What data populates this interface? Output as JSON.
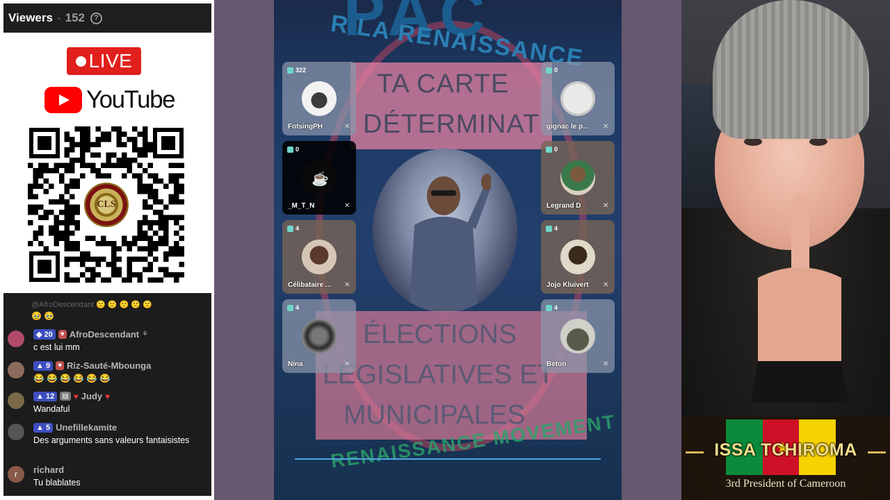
{
  "viewers": {
    "label": "Viewers",
    "separator": "·",
    "count": "152",
    "help_icon": "question-circle-icon"
  },
  "live_badge": {
    "text": "LIVE"
  },
  "youtube": {
    "text": "YouTube"
  },
  "qr_seal": {
    "text": "CLS"
  },
  "chat": {
    "faded_top": "@AfroDescendant 🙁 🙁 🙁 🙁 🙁",
    "faded_emojis": "🥹 🥹",
    "messages": [
      {
        "level": "20",
        "name": "AfroDescendant",
        "text": "c est lui mm",
        "avatar_color": "#b24a6a"
      },
      {
        "level": "9",
        "name": "Riz-Sauté-Mbounga",
        "text": "😂 😂 😂 😂 😂 😂",
        "avatar_color": "#8d6b5a"
      },
      {
        "level": "12",
        "name": "Judy",
        "text": "Wandaful",
        "avatar_color": "#7a6a4a"
      },
      {
        "level": "5",
        "name": "Unefillekamite",
        "text": "Des arguments sans valeurs fantaisistes",
        "avatar_color": "#555555"
      },
      {
        "level": "",
        "name": "richard",
        "text": "Tu blablates",
        "avatar_color": "#8a5a4a",
        "avatar_letter": "r"
      }
    ]
  },
  "poster": {
    "top_text": "PAC",
    "renaissance": "R LA RENAISSANCE",
    "line1": "TA CARTE",
    "line2": "DÉTERMINAT",
    "line3": "ÉLECTIONS",
    "line4": "LÉGISLATIVES ET",
    "line5": "MUNICIPALES",
    "green_text": "RENAISSANCE MOVEMENT"
  },
  "participants": [
    {
      "name": "FotsingPH",
      "count": "322"
    },
    {
      "name": "gignac le p...",
      "count": "0"
    },
    {
      "name": "_M_T_N",
      "count": "0"
    },
    {
      "name": "Legrand D",
      "count": "0"
    },
    {
      "name": "Célibataire ...",
      "count": "4"
    },
    {
      "name": "Jojo Kluivert",
      "count": "4"
    },
    {
      "name": "Nina",
      "count": "4"
    },
    {
      "name": "Beton",
      "count": "4"
    }
  ],
  "name_overlay": {
    "name": "ISSA TCHIROMA",
    "subtitle": "3rd President of Cameroon"
  },
  "colors": {
    "live_red": "#e1201d",
    "youtube_red": "#ff0000",
    "chat_bg": "#1c1c1c",
    "level_badge": "#3d4fbf"
  }
}
